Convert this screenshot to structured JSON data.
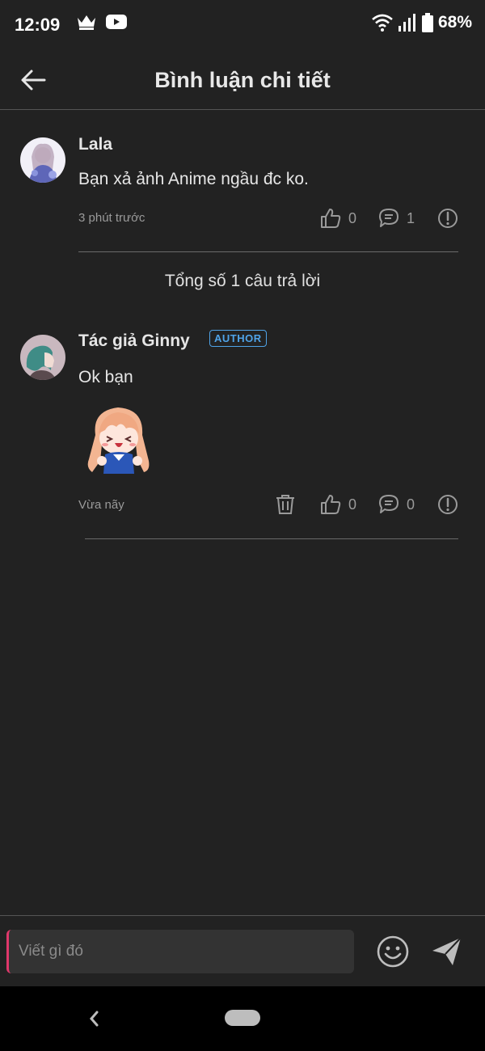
{
  "status_bar": {
    "time": "12:09",
    "battery": "68%"
  },
  "header": {
    "title": "Bình luận chi tiết"
  },
  "comment": {
    "username": "Lala",
    "text": "Bạn xả ảnh Anime ngầu đc ko.",
    "timestamp": "3 phút trước",
    "likes": "0",
    "replies": "1"
  },
  "reply_summary": "Tổng số 1 câu trả lời",
  "reply": {
    "username": "Tác giả Ginny",
    "badge": "AUTHOR",
    "text": "Ok bạn",
    "timestamp": "Vừa nãy",
    "likes": "0",
    "replies": "0"
  },
  "input": {
    "placeholder": "Viết gì đó"
  },
  "colors": {
    "background": "#222222",
    "accent_badge": "#4fa3e8",
    "cursor": "#e0386b"
  }
}
